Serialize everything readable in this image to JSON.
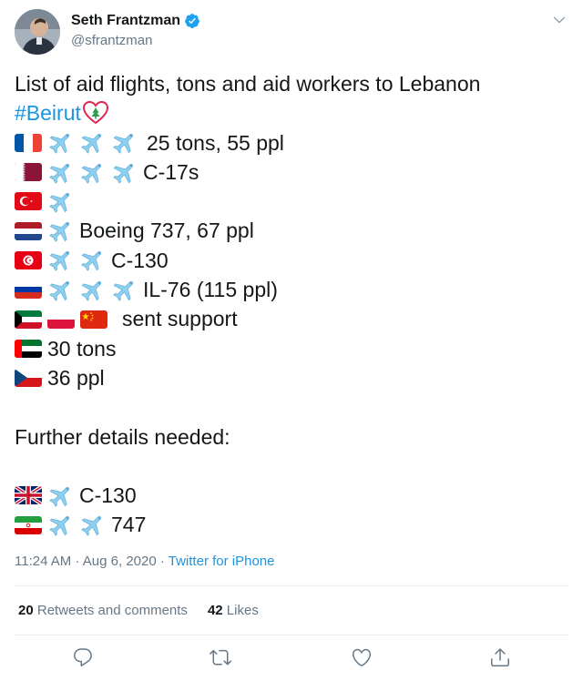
{
  "author": {
    "name": "Seth Frantzman",
    "handle": "@sfrantzman",
    "verified": true
  },
  "tweet": {
    "intro": "List of aid flights, tons and aid workers to Lebanon",
    "hashtag": "#Beirut",
    "rows": [
      {
        "flags": [
          "France"
        ],
        "planes": 3,
        "text": "25 tons, 55 ppl"
      },
      {
        "flags": [
          "Qatar"
        ],
        "planes": 3,
        "text": "C-17s"
      },
      {
        "flags": [
          "Turkey"
        ],
        "planes": 1,
        "text": ""
      },
      {
        "flags": [
          "Netherlands"
        ],
        "planes": 1,
        "text": "Boeing 737, 67 ppl"
      },
      {
        "flags": [
          "Tunisia"
        ],
        "planes": 2,
        "text": "C-130"
      },
      {
        "flags": [
          "Russia"
        ],
        "planes": 3,
        "text": "IL-76 (115 ppl)"
      },
      {
        "flags": [
          "Kuwait",
          "Poland",
          "China"
        ],
        "planes": 0,
        "text": "sent support"
      },
      {
        "flags": [
          "UAE"
        ],
        "planes": 0,
        "text": "30 tons"
      },
      {
        "flags": [
          "Czechia"
        ],
        "planes": 0,
        "text": "36 ppl"
      }
    ],
    "further": "Further details needed:",
    "further_rows": [
      {
        "flags": [
          "UK"
        ],
        "planes": 1,
        "text": "C-130"
      },
      {
        "flags": [
          "Iran"
        ],
        "planes": 2,
        "text": "747"
      }
    ]
  },
  "meta": {
    "time": "11:24 AM",
    "date": "Aug 6, 2020",
    "separator": "·",
    "source": "Twitter for iPhone"
  },
  "stats": {
    "retweets_count": "20",
    "retweets_label": "Retweets and comments",
    "likes_count": "42",
    "likes_label": "Likes"
  },
  "icons": {
    "reply": "reply-icon",
    "retweet": "retweet-icon",
    "like": "like-icon",
    "share": "share-icon"
  },
  "colors": {
    "link": "#1b95e0",
    "muted": "#657786",
    "verified": "#1da1f2",
    "plane": "#8ccfee"
  }
}
